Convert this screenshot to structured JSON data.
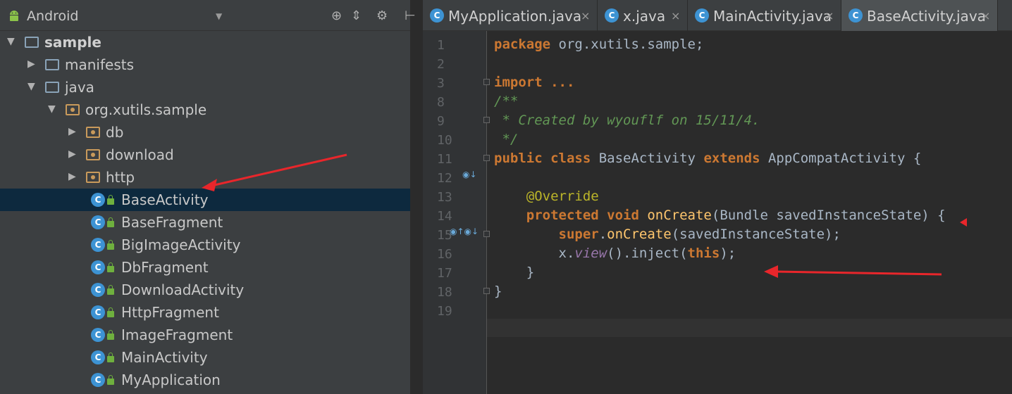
{
  "project_panel": {
    "view_mode": "Android",
    "tree": [
      {
        "label": "sample",
        "level": 0,
        "expanded": true,
        "kind": "module",
        "bold": true
      },
      {
        "label": "manifests",
        "level": 1,
        "expanded": false,
        "kind": "folder"
      },
      {
        "label": "java",
        "level": 1,
        "expanded": true,
        "kind": "folder"
      },
      {
        "label": "org.xutils.sample",
        "level": 2,
        "expanded": true,
        "kind": "package"
      },
      {
        "label": "db",
        "level": 3,
        "expanded": false,
        "kind": "package"
      },
      {
        "label": "download",
        "level": 3,
        "expanded": false,
        "kind": "package"
      },
      {
        "label": "http",
        "level": 3,
        "expanded": false,
        "kind": "package"
      },
      {
        "label": "BaseActivity",
        "level": 3,
        "kind": "class",
        "selected": true
      },
      {
        "label": "BaseFragment",
        "level": 3,
        "kind": "class"
      },
      {
        "label": "BigImageActivity",
        "level": 3,
        "kind": "class"
      },
      {
        "label": "DbFragment",
        "level": 3,
        "kind": "class"
      },
      {
        "label": "DownloadActivity",
        "level": 3,
        "kind": "class"
      },
      {
        "label": "HttpFragment",
        "level": 3,
        "kind": "class"
      },
      {
        "label": "ImageFragment",
        "level": 3,
        "kind": "class"
      },
      {
        "label": "MainActivity",
        "level": 3,
        "kind": "class"
      },
      {
        "label": "MyApplication",
        "level": 3,
        "kind": "class"
      }
    ]
  },
  "tabs": [
    {
      "label": "MyApplication.java",
      "active": false
    },
    {
      "label": "x.java",
      "active": false
    },
    {
      "label": "MainActivity.java",
      "active": false
    },
    {
      "label": "BaseActivity.java",
      "active": true
    }
  ],
  "editor": {
    "lines": [
      {
        "num": "1",
        "tokens": [
          [
            "kw",
            "package "
          ],
          [
            "cls",
            "org.xutils.sample;"
          ]
        ]
      },
      {
        "num": "2",
        "tokens": []
      },
      {
        "num": "3",
        "tokens": [
          [
            "kw",
            "import "
          ],
          [
            "kw",
            "..."
          ]
        ]
      },
      {
        "num": "8",
        "tokens": [
          [
            "cmt",
            "/**"
          ]
        ]
      },
      {
        "num": "9",
        "tokens": [
          [
            "cmt",
            " * Created by wyouflf on 15/11/4."
          ]
        ]
      },
      {
        "num": "10",
        "tokens": [
          [
            "cmt",
            " */"
          ]
        ]
      },
      {
        "num": "11",
        "tokens": [
          [
            "kw",
            "public class "
          ],
          [
            "cls",
            "BaseActivity "
          ],
          [
            "kw",
            "extends "
          ],
          [
            "cls",
            "AppCompatActivity {"
          ]
        ]
      },
      {
        "num": "12",
        "tokens": []
      },
      {
        "num": "13",
        "tokens": [
          [
            "cls",
            "    "
          ],
          [
            "ann",
            "@Override"
          ]
        ]
      },
      {
        "num": "14",
        "tokens": [
          [
            "cls",
            "    "
          ],
          [
            "kw",
            "protected void "
          ],
          [
            "meth",
            "onCreate"
          ],
          [
            "cls",
            "(Bundle savedInstanceState) {"
          ]
        ]
      },
      {
        "num": "15",
        "tokens": [
          [
            "cls",
            "        "
          ],
          [
            "kw",
            "super"
          ],
          [
            "cls",
            "."
          ],
          [
            "meth",
            "onCreate"
          ],
          [
            "cls",
            "(savedInstanceState);"
          ]
        ]
      },
      {
        "num": "16",
        "tokens": [
          [
            "cls",
            "        x."
          ],
          [
            "ital",
            "view"
          ],
          [
            "cls",
            "().inject("
          ],
          [
            "kw",
            "this"
          ],
          [
            "cls",
            ");"
          ]
        ]
      },
      {
        "num": "17",
        "tokens": [
          [
            "cls",
            "    }"
          ]
        ]
      },
      {
        "num": "18",
        "tokens": [
          [
            "cls",
            "}"
          ]
        ]
      },
      {
        "num": "19",
        "tokens": []
      }
    ]
  },
  "colors": {
    "panel_bg": "#3c3f41",
    "editor_bg": "#2b2b2b",
    "selection": "#0d293e",
    "annotation_arrow": "#e8262b"
  }
}
